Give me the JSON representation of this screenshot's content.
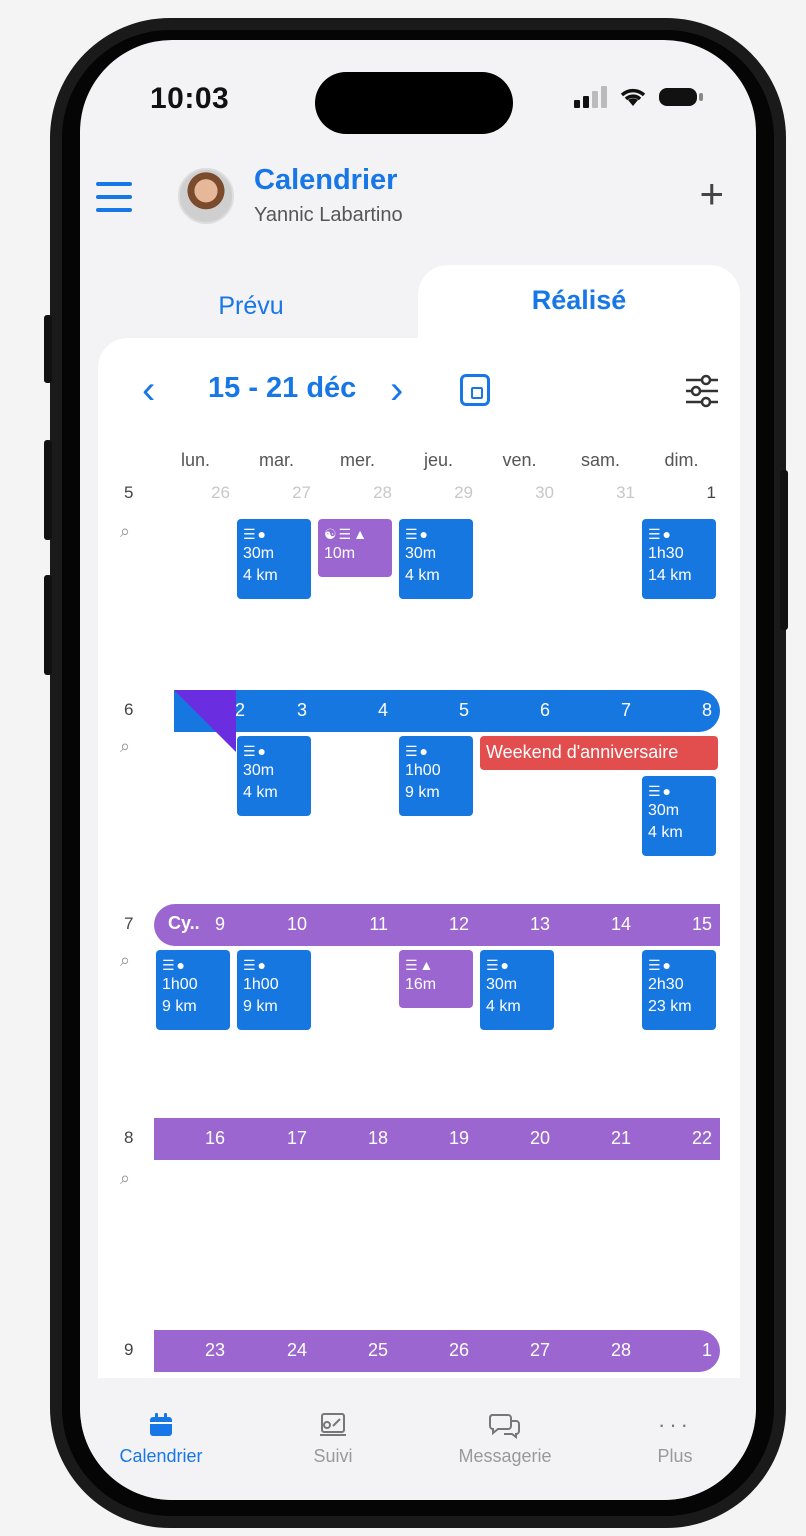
{
  "status_bar": {
    "time": "10:03"
  },
  "header": {
    "title": "Calendrier",
    "user_name": "Yannic Labartino",
    "add_label": "+"
  },
  "tabs": [
    {
      "label": "Prévu"
    },
    {
      "label": "Réalisé"
    }
  ],
  "week_nav": {
    "range": "15 - 21 déc",
    "prev_label": "‹",
    "next_label": "›"
  },
  "day_headers": [
    "lun.",
    "mar.",
    "mer.",
    "jeu.",
    "ven.",
    "sam.",
    "dim."
  ],
  "weeks": [
    {
      "number": "5",
      "days": [
        "26",
        "27",
        "28",
        "29",
        "30",
        "31",
        "1"
      ]
    },
    {
      "number": "6",
      "days": [
        "2",
        "3",
        "4",
        "5",
        "6",
        "7",
        "8"
      ]
    },
    {
      "number": "7",
      "start_label": "Cy..",
      "days": [
        "9",
        "10",
        "11",
        "12",
        "13",
        "14",
        "15"
      ]
    },
    {
      "number": "8",
      "days": [
        "16",
        "17",
        "18",
        "19",
        "20",
        "21",
        "22"
      ]
    },
    {
      "number": "9",
      "days": [
        "23",
        "24",
        "25",
        "26",
        "27",
        "28",
        "1"
      ]
    }
  ],
  "workouts": [
    {
      "week": 0,
      "day": 1,
      "color": "blue",
      "duration": "30m",
      "distance": "4 km"
    },
    {
      "week": 0,
      "day": 2,
      "color": "purple",
      "duration": "10m",
      "distance": ""
    },
    {
      "week": 0,
      "day": 3,
      "color": "blue",
      "duration": "30m",
      "distance": "4 km"
    },
    {
      "week": 0,
      "day": 6,
      "color": "blue",
      "duration": "1h30",
      "distance": "14 km"
    },
    {
      "week": 1,
      "day": 1,
      "color": "blue",
      "duration": "30m",
      "distance": "4 km"
    },
    {
      "week": 1,
      "day": 3,
      "color": "blue",
      "duration": "1h00",
      "distance": "9 km"
    },
    {
      "week": 1,
      "day": 6,
      "color": "blue",
      "duration": "30m",
      "distance": "4 km"
    },
    {
      "week": 2,
      "day": 0,
      "color": "blue",
      "duration": "1h00",
      "distance": "9 km"
    },
    {
      "week": 2,
      "day": 1,
      "color": "blue",
      "duration": "1h00",
      "distance": "9 km"
    },
    {
      "week": 2,
      "day": 3,
      "color": "purple",
      "duration": "16m",
      "distance": ""
    },
    {
      "week": 2,
      "day": 4,
      "color": "blue",
      "duration": "30m",
      "distance": "4 km"
    },
    {
      "week": 2,
      "day": 6,
      "color": "blue",
      "duration": "2h30",
      "distance": "23 km"
    }
  ],
  "events": [
    {
      "label": "Weekend d'anniversaire",
      "color": "#e24d4d"
    }
  ],
  "bottom_nav": [
    {
      "label": "Calendrier",
      "active": true
    },
    {
      "label": "Suivi"
    },
    {
      "label": "Messagerie"
    },
    {
      "label": "Plus"
    }
  ],
  "colors": {
    "accent": "#1877e6",
    "run": "#1677e0",
    "strength": "#9b66d0",
    "event": "#e24d4d",
    "marker": "#6a2ee0"
  }
}
